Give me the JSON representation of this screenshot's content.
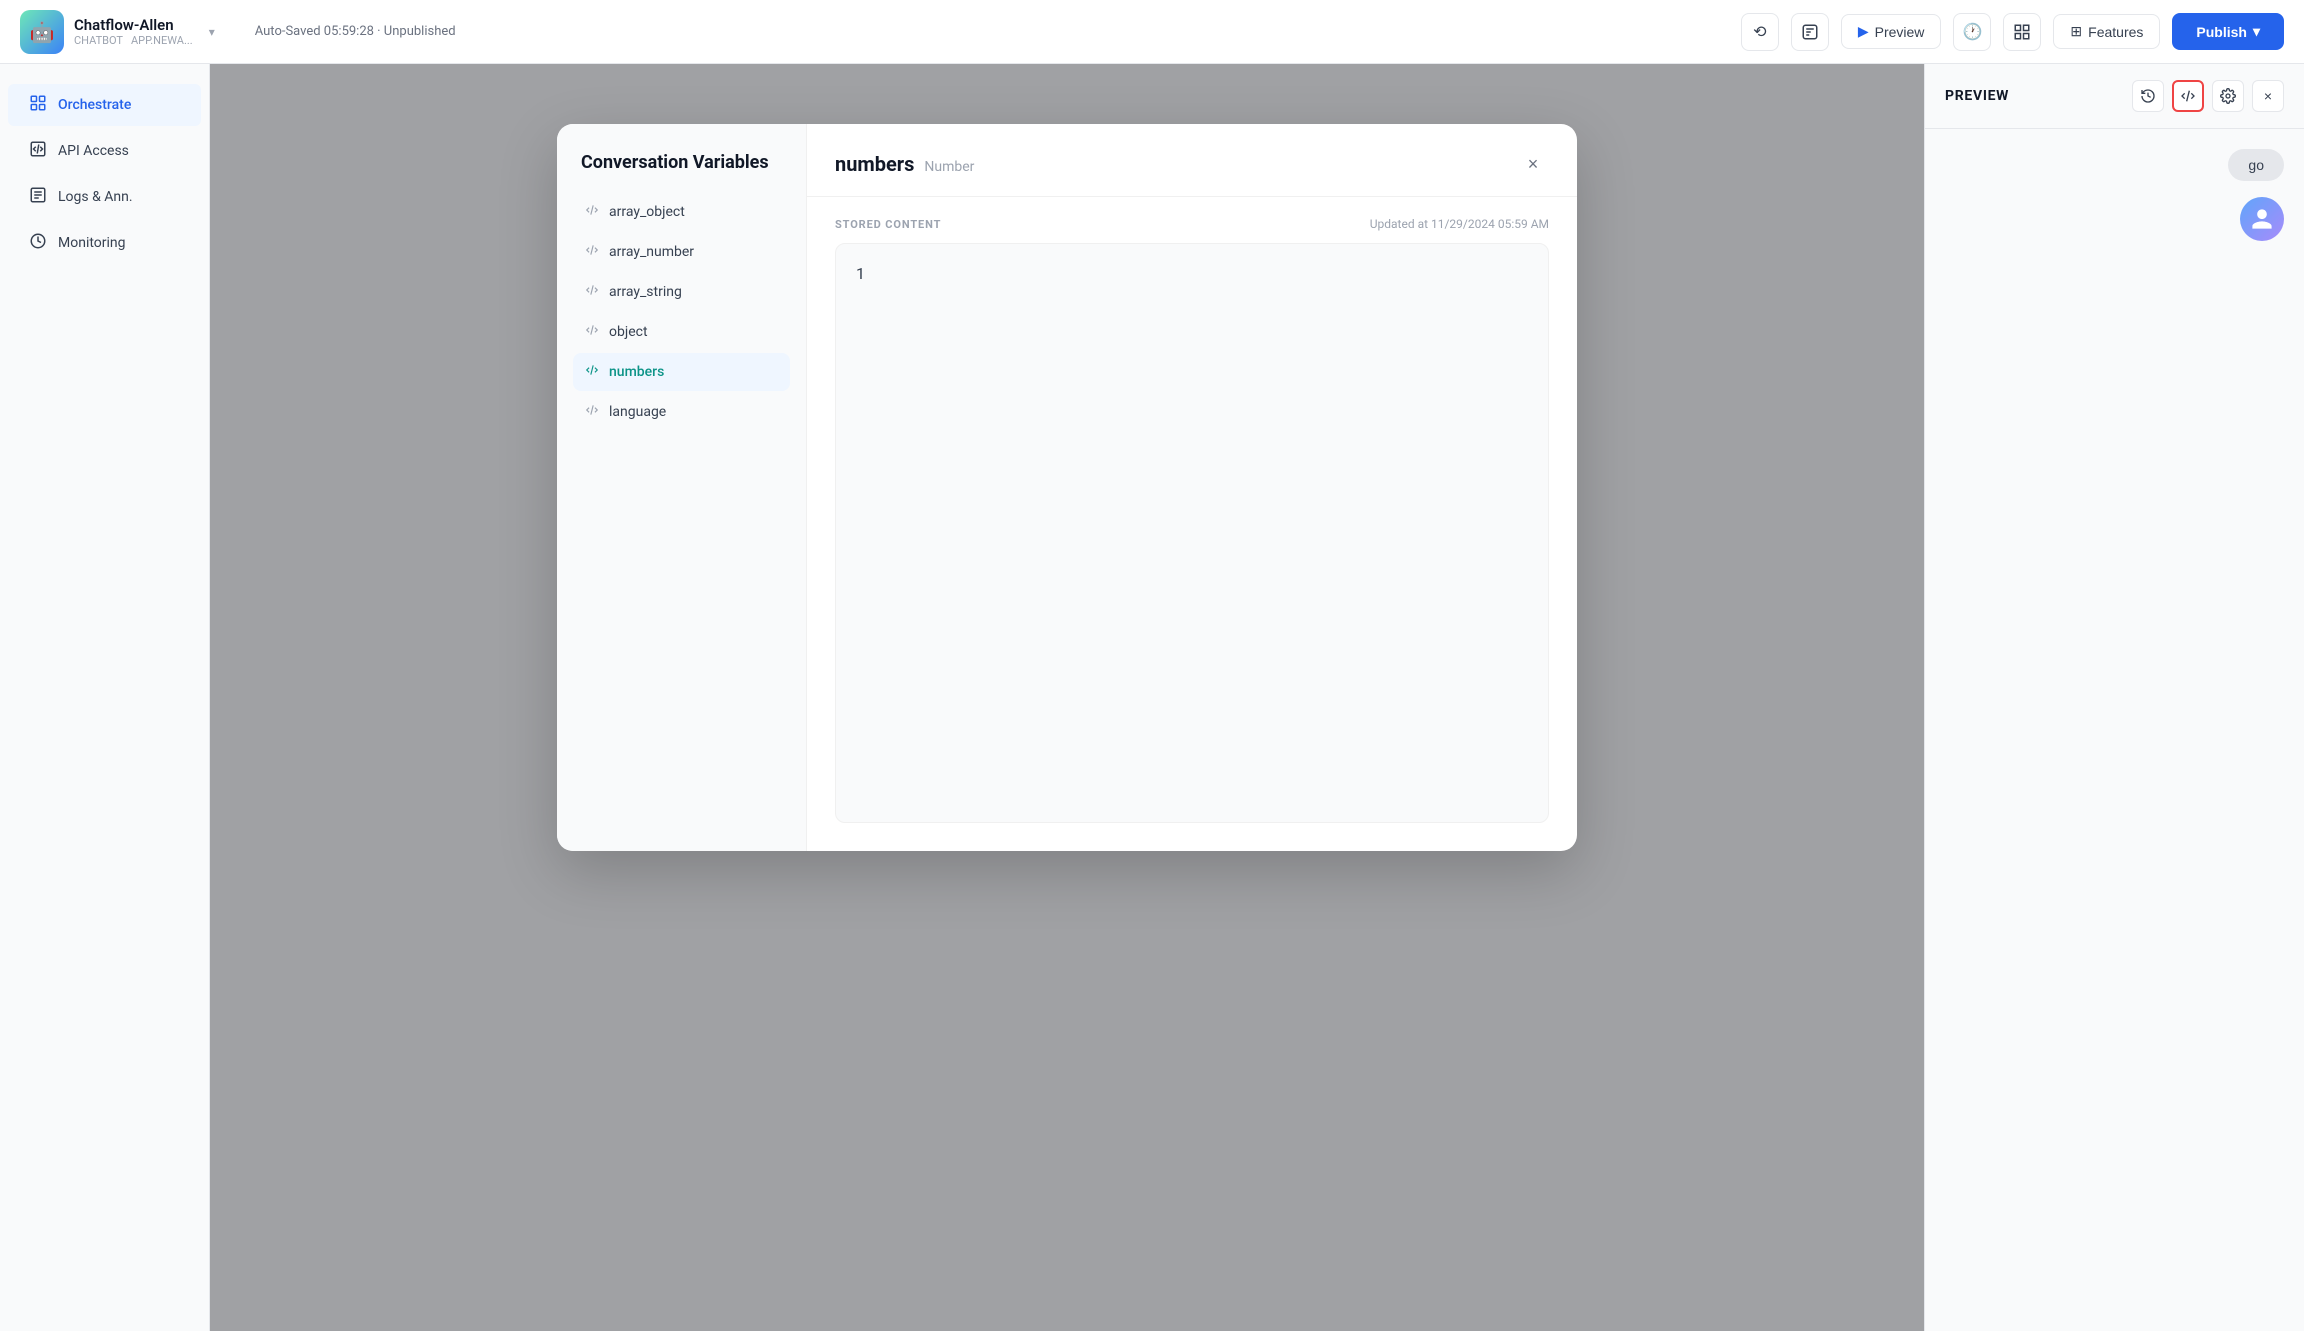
{
  "app": {
    "name": "Chatflow-Allen",
    "type": "CHATBOT",
    "domain": "APP.NEWA...",
    "icon": "🤖"
  },
  "topbar": {
    "autosave": "Auto-Saved 05:59:28 · Unpublished",
    "preview_label": "Preview",
    "features_label": "Features",
    "publish_label": "Publish"
  },
  "sidebar": {
    "items": [
      {
        "label": "Orchestrate",
        "icon": "⊞",
        "active": true
      },
      {
        "label": "API Access",
        "icon": "◫",
        "active": false
      },
      {
        "label": "Logs & Ann.",
        "icon": "☰",
        "active": false
      },
      {
        "label": "Monitoring",
        "icon": "◉",
        "active": false
      }
    ]
  },
  "preview": {
    "title": "PREVIEW",
    "go_label": "go",
    "close_label": "×"
  },
  "modal": {
    "sidebar_title": "Conversation Variables",
    "nav_items": [
      {
        "label": "array_object",
        "active": false
      },
      {
        "label": "array_number",
        "active": false
      },
      {
        "label": "array_string",
        "active": false
      },
      {
        "label": "object",
        "active": false
      },
      {
        "label": "numbers",
        "active": true
      },
      {
        "label": "language",
        "active": false
      }
    ],
    "var_name": "numbers",
    "var_type": "Number",
    "stored_content_label": "STORED CONTENT",
    "timestamp": "Updated at 11/29/2024 05:59 AM",
    "stored_value": "1",
    "close_label": "×"
  }
}
